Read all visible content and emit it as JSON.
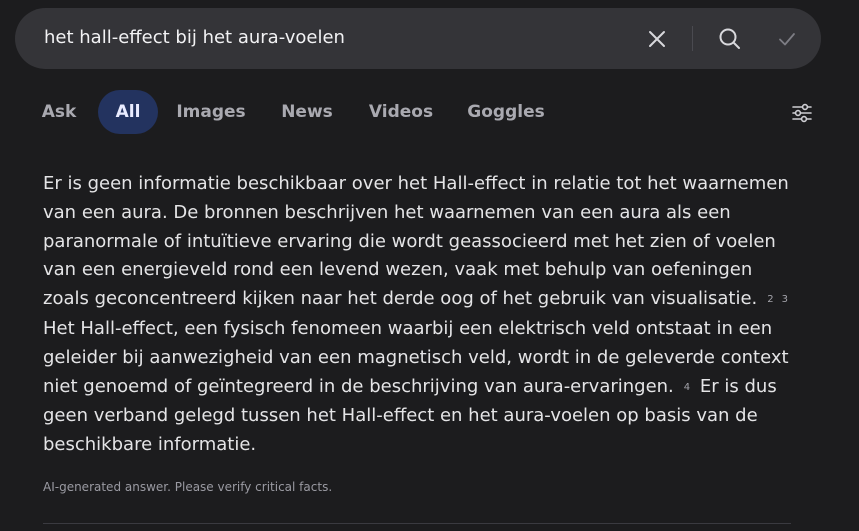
{
  "search": {
    "query": "het hall-effect bij het aura-voelen",
    "icons": {
      "clear": "close-icon",
      "search": "search-icon",
      "confirm": "checkmark-icon"
    }
  },
  "tabs": [
    {
      "label": "Ask",
      "active": false
    },
    {
      "label": "All",
      "active": true
    },
    {
      "label": "Images",
      "active": false
    },
    {
      "label": "News",
      "active": false
    },
    {
      "label": "Videos",
      "active": false
    },
    {
      "label": "Goggles",
      "active": false
    }
  ],
  "filter": {
    "icon": "sliders-icon"
  },
  "answer": {
    "part1": "Er is geen informatie beschikbaar over het Hall-effect in relatie tot het waarnemen van een aura. De bronnen beschrijven het waarnemen van een aura als een paranormale of intuïtieve ervaring die wordt geassocieerd met het zien of voelen van een energieveld rond een levend wezen, vaak met behulp van oefeningen zoals geconcentreerd kijken naar het derde oog of het gebruik van visualisatie.",
    "cite1": "2",
    "cite2": "3",
    "part2": "Het Hall-effect, een fysisch fenomeen waarbij een elektrisch veld ontstaat in een geleider bij aanwezigheid van een magnetisch veld, wordt in de geleverde context niet genoemd of geïntegreerd in de beschrijving van aura-ervaringen.",
    "cite3": "4",
    "part3": "Er is dus geen verband gelegd tussen het Hall-effect en het aura-voelen op basis van de beschikbare informatie."
  },
  "disclaimer": "AI-generated answer. Please verify critical facts.",
  "colors": {
    "background": "#1c1c1e",
    "search_bar": "#343438",
    "active_tab": "#23335f"
  }
}
